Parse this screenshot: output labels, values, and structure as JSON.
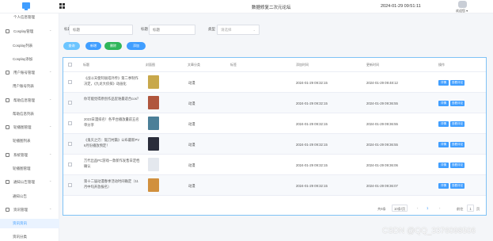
{
  "header": {
    "title": "数据修复二次元论坛",
    "datetime": "2024-01-29 09:51:11",
    "user_label": "欢迎您 ▾"
  },
  "sidebar": {
    "items": [
      {
        "label": "个人信息管理",
        "type": "sub"
      },
      {
        "label": "Cosplay管理",
        "type": "group"
      },
      {
        "label": "Cosplay列表",
        "type": "sub"
      },
      {
        "label": "Cosplay添加",
        "type": "sub"
      },
      {
        "label": "用户账号管理",
        "type": "group"
      },
      {
        "label": "用户账号列表",
        "type": "sub"
      },
      {
        "label": "帮助信息管理",
        "type": "group"
      },
      {
        "label": "帮助信息列表",
        "type": "sub"
      },
      {
        "label": "轮播图管理",
        "type": "group"
      },
      {
        "label": "轮播图列表",
        "type": "sub"
      },
      {
        "label": "系统管理",
        "type": "group"
      },
      {
        "label": "轮播图管理",
        "type": "sub"
      },
      {
        "label": "通知公告管理",
        "type": "group"
      },
      {
        "label": "通知公告",
        "type": "sub"
      },
      {
        "label": "资讯管理",
        "type": "group"
      },
      {
        "label": "资讯资讯",
        "type": "sub"
      },
      {
        "label": "资讯分类",
        "type": "sub"
      }
    ]
  },
  "search": {
    "title_label": "标题",
    "title_placeholder": "标题",
    "name_label": "标题",
    "name_placeholder": "标题",
    "type_label": "类型",
    "type_placeholder": "请选择"
  },
  "toolbar": {
    "search": "查询",
    "add": "新增",
    "delete": "删除",
    "more": "添加"
  },
  "table": {
    "columns": [
      "标题",
      "封面图",
      "文章分类",
      "标签",
      "添加时间",
      "更新时间",
      "操作"
    ],
    "rows": [
      {
        "title": "《战斗天使阿丽塔外传》第二季制作决定，《九龙大侦探》动画化",
        "type": "动漫",
        "added": "2024-01-29 09:32:15",
        "updated": "2024-01-29 09:48:12",
        "thumb": "#c8a84b"
      },
      {
        "title": "你可能觉得原创作品里谁最适合cos？",
        "type": "动漫",
        "added": "2024-01-29 09:32:15",
        "updated": "2024-01-29 09:36:55",
        "thumb": "#b0563d"
      },
      {
        "title": "2023日漫排名！各平台播放量前五名单分享",
        "type": "动漫",
        "added": "2024-01-29 09:32:15",
        "updated": "2024-01-29 09:36:55",
        "thumb": "#4b7f98"
      },
      {
        "title": "《鬼灭之刃：锻刀村篇》公布最新PV 6月份播放预定！",
        "type": "动漫",
        "added": "2024-01-29 09:32:15",
        "updated": "2024-01-29 09:36:55",
        "thumb": "#2a2d3a"
      },
      {
        "title": "万代出品PC游戏一款新作发售日定档确认",
        "type": "动漫",
        "added": "2024-01-29 09:32:15",
        "updated": "2024-01-29 09:36:06",
        "thumb": "#e4e8ee"
      },
      {
        "title": "第十二届动漫春季活动时间确定（11月中旬开放报名）",
        "type": "动漫",
        "added": "2024-01-29 09:32:15",
        "updated": "2024-01-29 09:36:07",
        "thumb": "#d1903e"
      }
    ],
    "op_detail": "详情",
    "op_edit": "查看评论"
  },
  "pager": {
    "total": "共6条",
    "size": "10条/页",
    "prev": "‹",
    "current": "1",
    "next": "›",
    "goto": "前往",
    "input": "1",
    "page": "页"
  },
  "watermark": "CSDN @QQ_3376098506",
  "colors": {
    "primary": "#409eff",
    "success": "#2fb65a",
    "light_blue": "#6cc5ff",
    "table_border": "#7fc2f5"
  }
}
